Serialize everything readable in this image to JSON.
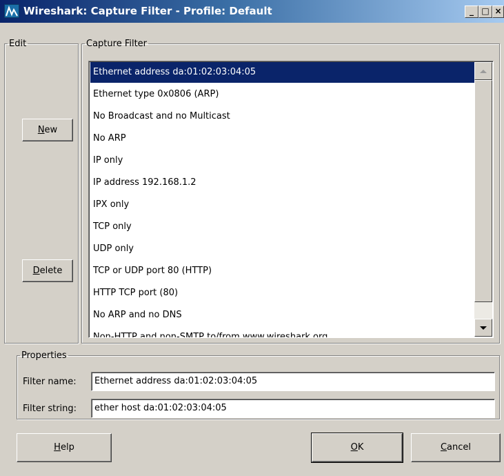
{
  "window": {
    "title": "Wireshark: Capture Filter - Profile: Default",
    "controls": {
      "minimize": "_",
      "maximize": "□",
      "close": "×"
    }
  },
  "edit_group": {
    "legend": "Edit",
    "new_button": {
      "accel": "N",
      "rest": "ew"
    },
    "delete_button": {
      "accel": "D",
      "rest": "elete"
    }
  },
  "capture_filter_group": {
    "legend": "Capture Filter",
    "selected_index": 0,
    "items": [
      "Ethernet address da:01:02:03:04:05",
      "Ethernet type 0x0806 (ARP)",
      "No Broadcast and no Multicast",
      "No ARP",
      "IP only",
      "IP address 192.168.1.2",
      "IPX only",
      "TCP only",
      "UDP only",
      "TCP or UDP port 80 (HTTP)",
      "HTTP TCP port (80)",
      "No ARP and no DNS",
      "Non-HTTP and non-SMTP to/from www.wireshark.org"
    ]
  },
  "properties_group": {
    "legend": "Properties",
    "filter_name_label": "Filter name:",
    "filter_name_value": "Ethernet address da:01:02:03:04:05",
    "filter_string_label": "Filter string:",
    "filter_string_value": "ether host da:01:02:03:04:05"
  },
  "footer": {
    "help_button": {
      "accel": "H",
      "rest": "elp"
    },
    "ok_button": {
      "accel": "O",
      "rest": "K"
    },
    "cancel_button": {
      "accel": "C",
      "rest": "ancel"
    }
  }
}
